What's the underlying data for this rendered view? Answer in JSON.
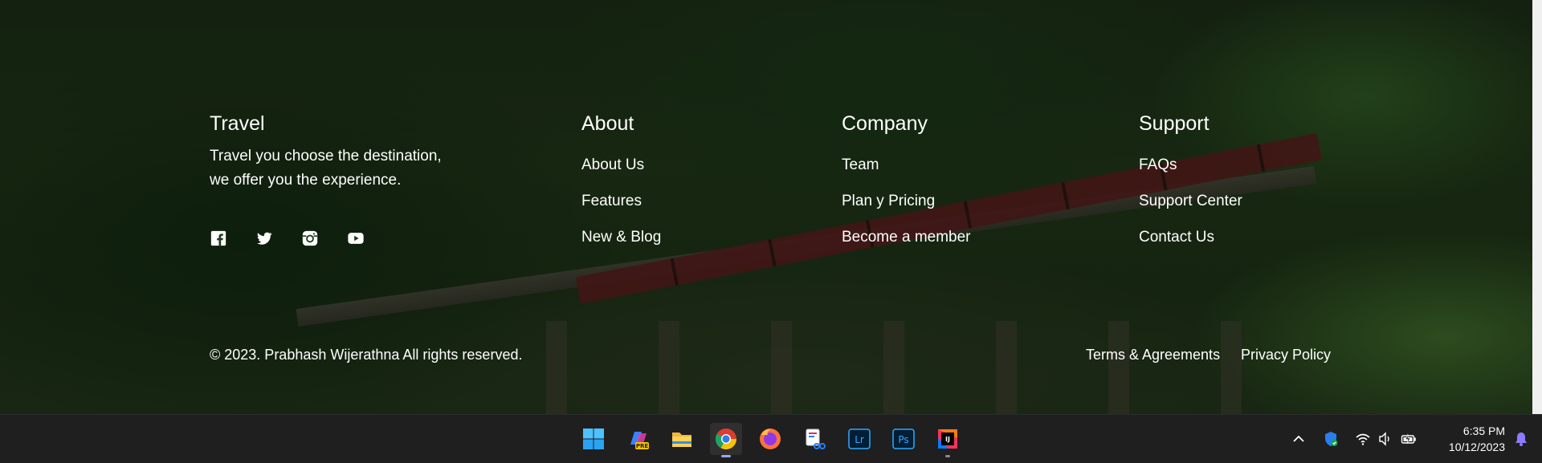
{
  "footer": {
    "brand": {
      "title": "Travel",
      "tagline_line1": "Travel you choose the destination,",
      "tagline_line2": "we offer you the experience.",
      "social": [
        {
          "icon": "facebook-icon"
        },
        {
          "icon": "twitter-icon"
        },
        {
          "icon": "instagram-icon"
        },
        {
          "icon": "youtube-icon"
        }
      ]
    },
    "about": {
      "title": "About",
      "links": [
        "About Us",
        "Features",
        "New & Blog"
      ]
    },
    "company": {
      "title": "Company",
      "links": [
        "Team",
        "Plan y Pricing",
        "Become a member"
      ]
    },
    "support": {
      "title": "Support",
      "links": [
        "FAQs",
        "Support Center",
        "Contact Us"
      ]
    },
    "copyright": "© 2023. Prabhash Wijerathna All rights reserved.",
    "legal": {
      "terms": "Terms & Agreements",
      "privacy": "Privacy Policy"
    }
  },
  "taskbar": {
    "apps": [
      {
        "icon": "windows-start-icon"
      },
      {
        "icon": "copilot-pre-icon",
        "badge": "PRE"
      },
      {
        "icon": "file-explorer-icon"
      },
      {
        "icon": "chrome-icon",
        "active": true
      },
      {
        "icon": "firefox-icon"
      },
      {
        "icon": "snipping-tool-icon"
      },
      {
        "icon": "lightroom-icon",
        "label": "Lr"
      },
      {
        "icon": "photoshop-icon",
        "label": "Ps"
      },
      {
        "icon": "intellij-icon",
        "label": "IJ"
      }
    ],
    "tray": [
      "chevron-up-icon",
      "shield-icon",
      "wifi-icon",
      "volume-icon",
      "battery-icon"
    ],
    "time": "6:35 PM",
    "date": "10/12/2023",
    "notification_icon": "bell-icon"
  },
  "colors": {
    "taskbar_bg": "#1f1f1f",
    "text": "#ffffff",
    "active_indicator": "#9aa5ff"
  }
}
